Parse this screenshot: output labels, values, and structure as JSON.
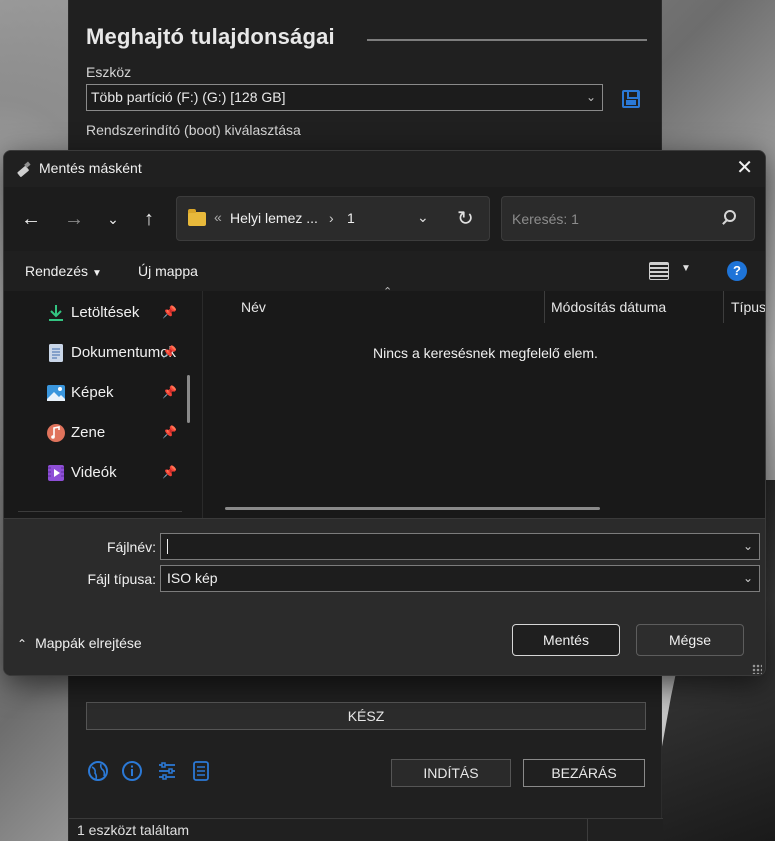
{
  "rufus": {
    "heading": "Meghajtó tulajdonságai",
    "device_label": "Eszköz",
    "device_value": "Több partíció (F:) (G:) [128 GB]",
    "boot_label": "Rendszerindító (boot) kiválasztása",
    "progress_text": "KÉSZ",
    "start_button": "INDÍTÁS",
    "close_button": "BEZÁRÁS",
    "status_text": "1 eszközt találtam"
  },
  "dialog": {
    "title": "Mentés másként",
    "address": {
      "overflow": "«",
      "segment1": "Helyi lemez ...",
      "chevron": "›",
      "segment2": "1"
    },
    "search_placeholder": "Keresés: 1",
    "toolbar": {
      "organize": "Rendezés",
      "new_folder": "Új mappa"
    },
    "sidebar": {
      "items": [
        {
          "label": "Letöltések",
          "icon": "download-icon"
        },
        {
          "label": "Dokumentumok",
          "icon": "documents-icon"
        },
        {
          "label": "Képek",
          "icon": "pictures-icon"
        },
        {
          "label": "Zene",
          "icon": "music-icon"
        },
        {
          "label": "Videók",
          "icon": "videos-icon"
        }
      ]
    },
    "columns": [
      "Név",
      "Módosítás dátuma",
      "Típus"
    ],
    "empty_message": "Nincs a keresésnek megfelelő elem.",
    "filename_label": "Fájlnév:",
    "filename_value": "",
    "filetype_label": "Fájl típusa:",
    "filetype_value": "ISO kép",
    "hide_folders": "Mappák elrejtése",
    "save_button": "Mentés",
    "cancel_button": "Mégse"
  },
  "colors": {
    "accent_blue": "#2b79d6",
    "dialog_bg": "#191919",
    "app_bg": "#202020",
    "folder_yellow": "#e8b93b"
  }
}
